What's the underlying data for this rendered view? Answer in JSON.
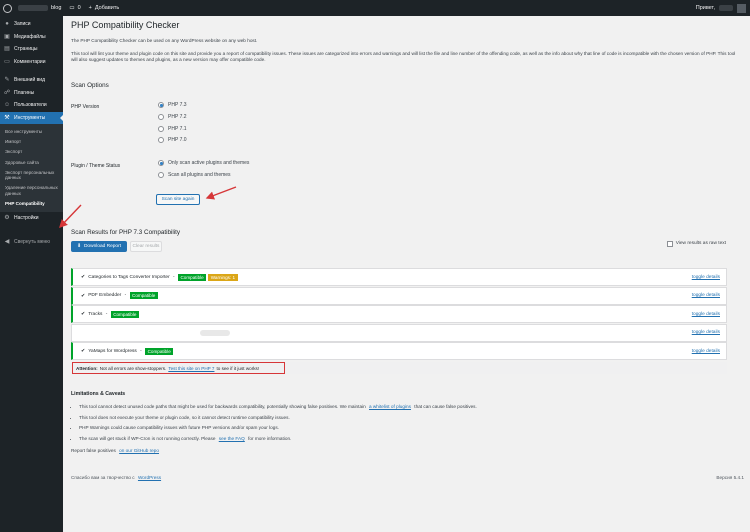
{
  "adminbar": {
    "site_label": "blog",
    "comments_count": "0",
    "new_label": "Добавить",
    "greeting": "Привет,"
  },
  "sidebar": {
    "items": [
      {
        "label": "Записи",
        "icon": "pin-icon"
      },
      {
        "label": "Медиафайлы",
        "icon": "media-icon"
      },
      {
        "label": "Страницы",
        "icon": "page-icon"
      },
      {
        "label": "Комментарии",
        "icon": "comment-icon"
      },
      {
        "label": "Внешний вид",
        "icon": "brush-icon"
      },
      {
        "label": "Плагины",
        "icon": "plugin-icon"
      },
      {
        "label": "Пользователи",
        "icon": "users-icon"
      },
      {
        "label": "Инструменты",
        "icon": "wrench-icon"
      }
    ],
    "submenu": [
      "Все инструменты",
      "Импорт",
      "Экспорт",
      "Здоровье сайта",
      "Экспорт персональных данных",
      "Удаление персональных данных",
      "PHP Compatibility"
    ],
    "settings_label": "Настройки",
    "collapse_label": "Свернуть меню"
  },
  "page": {
    "title": "PHP Compatibility Checker",
    "intro1": "The PHP Compatibility Checker can be used on any WordPress website on any web host.",
    "intro2": "This tool will lint your theme and plugin code on this site and provide you a report of compatibility issues. These issues are categorized into errors and warnings and will list the file and line number of the offending code, as well as the info about why that line of code is incompatible with the chosen version of PHP. This tool will also suggest updates to themes and plugins, as a new version may offer compatible code.",
    "scan_options_heading": "Scan Options",
    "php_version_label": "PHP Version",
    "php_versions": [
      "PHP 7.3",
      "PHP 7.2",
      "PHP 7.1",
      "PHP 7.0"
    ],
    "status_label": "Plugin / Theme Status",
    "status_options": [
      "Only scan active plugins and themes",
      "Scan all plugins and themes"
    ],
    "scan_button": "Scan site again",
    "results_heading": "Scan Results for PHP 7.3 Compatibility",
    "download_button": "Download Report",
    "clear_button": "Clear results",
    "raw_text_label": "View results as raw text",
    "results": [
      {
        "name": "Categories to Tags Converter Importer",
        "badges": [
          "Compatible",
          "Warnings: 1"
        ],
        "toggle": "toggle details"
      },
      {
        "name": "PDF Embedder",
        "badges": [
          "Compatible"
        ],
        "toggle": "toggle details"
      },
      {
        "name": "Tracks",
        "badges": [
          "Compatible"
        ],
        "toggle": "toggle details"
      },
      {
        "name": "",
        "badges": [],
        "toggle": "toggle details"
      },
      {
        "name": "YaMaps for Wordpress",
        "badges": [
          "Compatible"
        ],
        "toggle": "toggle details"
      }
    ],
    "attention": {
      "strong": "Attention:",
      "text1": "Not all errors are show-stoppers.",
      "link": "Test this site on PHP 7",
      "text2": "to see if it just works!"
    },
    "limits_heading": "Limitations & Caveats",
    "limits": [
      {
        "text": "This tool cannot detect unused code paths that might be used for backwards compatibility, potentially showing false positives. We maintain",
        "link": "a whitelist of plugins",
        "after": "that can cause false positives."
      },
      {
        "text": "This tool does not execute your theme or plugin code, so it cannot detect runtime compatibility issues.",
        "link": "",
        "after": ""
      },
      {
        "text": "PHP Warnings could cause compatibility issues with future PHP versions and/or spam your logs.",
        "link": "",
        "after": ""
      },
      {
        "text": "The scan will get stuck if WP-Cron is not running correctly. Please",
        "link": "see the FAQ",
        "after": "for more information."
      }
    ],
    "report_text": "Report false positives",
    "report_link": "on our GitHub repo",
    "footer_left_text": "Спасибо вам за творчество с",
    "footer_left_link": "WordPress",
    "footer_right": "Версия 5.4.1"
  },
  "colors": {
    "admin_dark": "#1d2327",
    "accent": "#2271b1",
    "ok": "#00a32a",
    "warn": "#dba617",
    "alert": "#d63638"
  }
}
